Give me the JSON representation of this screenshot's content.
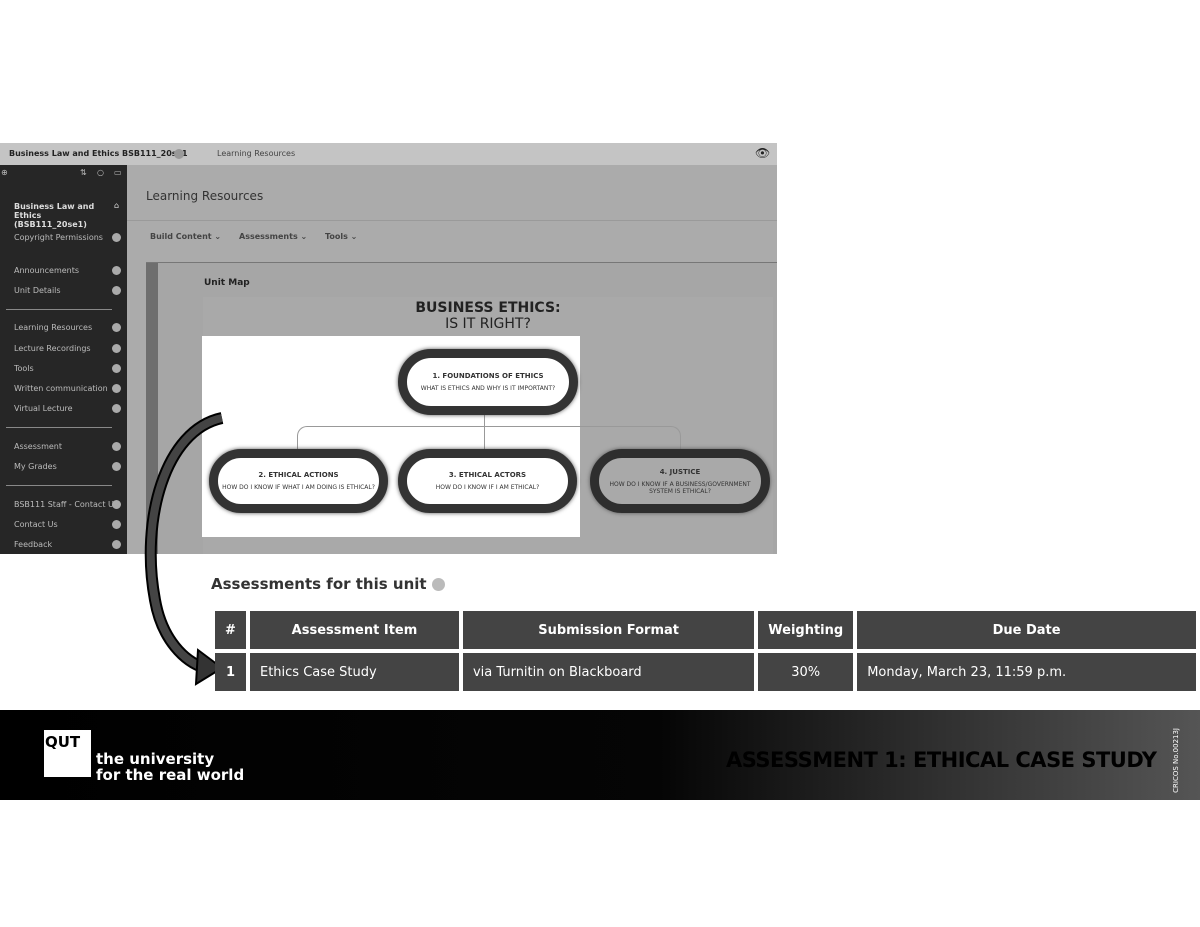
{
  "blackboard": {
    "course_title": "Business Law and Ethics BSB111_20se1",
    "breadcrumb": "Learning Resources",
    "sidebar": {
      "course_name": "Business Law and Ethics (BSB111_20se1)",
      "items": [
        "Copyright Permissions",
        "Announcements",
        "Unit Details",
        "Learning Resources",
        "Lecture Recordings",
        "Tools",
        "Written communication",
        "Virtual Lecture",
        "Assessment",
        "My Grades",
        "BSB111 Staff - Contact Us",
        "Contact Us",
        "Feedback"
      ]
    },
    "page_title": "Learning Resources",
    "toolbar": [
      "Build Content",
      "Assessments",
      "Tools"
    ],
    "unit_map_label": "Unit Map",
    "diagram": {
      "title": "BUSINESS ETHICS:",
      "subtitle": "IS IT RIGHT?",
      "nodes": [
        {
          "title": "1. FOUNDATIONS OF ETHICS",
          "question": "WHAT IS ETHICS AND WHY IS IT IMPORTANT?"
        },
        {
          "title": "2. ETHICAL ACTIONS",
          "question": "HOW DO I KNOW IF WHAT I AM DOING IS ETHICAL?"
        },
        {
          "title": "3. ETHICAL ACTORS",
          "question": "HOW DO I KNOW IF I AM ETHICAL?"
        },
        {
          "title": "4. JUSTICE",
          "question": "HOW DO I KNOW IF A BUSINESS/GOVERNMENT SYSTEM IS ETHICAL?"
        }
      ]
    }
  },
  "assessments": {
    "title": "Assessments for this unit",
    "columns": [
      "#",
      "Assessment Item",
      "Submission Format",
      "Weighting",
      "Due Date"
    ],
    "rows": [
      [
        "1",
        "Ethics Case Study",
        "via Turnitin on Blackboard",
        "30%",
        "Monday, March 23, 11:59 p.m."
      ]
    ]
  },
  "footer": {
    "logo": "QUT",
    "tagline_1": "the university",
    "tagline_2": "for the real world",
    "slide_title": "ASSESSMENT 1: ETHICAL CASE STUDY",
    "cricos": "CRICOS No.00213J"
  }
}
